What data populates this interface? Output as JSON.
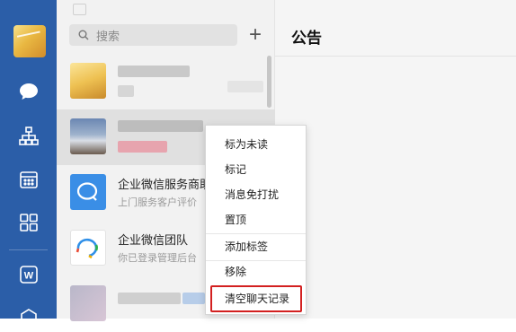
{
  "rail": {
    "icons": [
      "profile-avatar",
      "chat-bubble-icon",
      "org-chart-icon",
      "calendar-icon",
      "apps-grid-icon",
      "word-doc-icon",
      "more-icon"
    ]
  },
  "search": {
    "placeholder": "搜索"
  },
  "list": {
    "items": [
      {
        "name": "",
        "preview": ""
      },
      {
        "name": "",
        "preview": ""
      },
      {
        "name": "企业微信服务商助",
        "preview": "上门服务客户评价"
      },
      {
        "name": "企业微信团队",
        "preview": "你已登录管理后台"
      },
      {
        "name": "",
        "preview": ""
      }
    ]
  },
  "main": {
    "title": "公告"
  },
  "context_menu": {
    "items": [
      "标为未读",
      "标记",
      "消息免打扰",
      "置顶",
      "添加标签",
      "移除",
      "清空聊天记录"
    ],
    "highlighted_index": 6
  },
  "colors": {
    "rail": "#2b5ea8",
    "highlight": "#d32020"
  }
}
